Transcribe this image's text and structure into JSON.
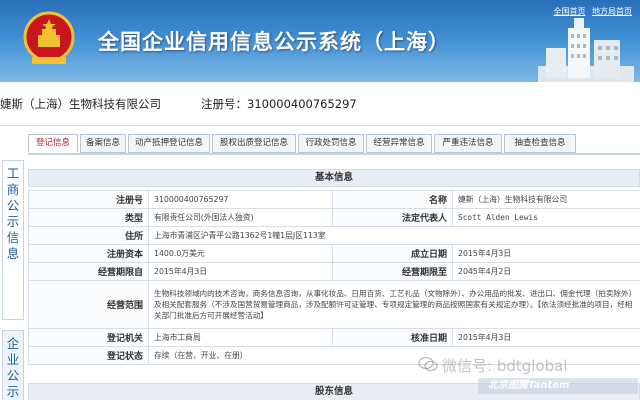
{
  "header": {
    "title": "全国企业信用信息公示系统（上海）",
    "links": [
      "全国首页",
      "地方局首页"
    ]
  },
  "company": {
    "name": "婕斯（上海）生物科技有限公司",
    "reg_label": "注册号：310000400765297"
  },
  "side_tabs": [
    {
      "label": "工商公示信息",
      "chars": [
        "工",
        "商",
        "公",
        "示",
        "信",
        "息"
      ]
    },
    {
      "label": "企业公示",
      "chars": [
        "企",
        "业",
        "公",
        "示"
      ]
    }
  ],
  "tabs": [
    "登记信息",
    "备案信息",
    "动产抵押登记信息",
    "股权出质登记信息",
    "行政处罚信息",
    "经营异常信息",
    "严重违法信息",
    "抽查检查信息"
  ],
  "basic": {
    "title": "基本信息",
    "reg_no_label": "注册号",
    "reg_no": "310000400765297",
    "name_label": "名称",
    "name": "婕斯（上海）生物科技有限公司",
    "type_label": "类型",
    "type": "有限责任公司(外国法人独资)",
    "rep_label": "法定代表人",
    "rep": "Scott Alden Lewis",
    "addr_label": "住所",
    "addr": "上海市青浦区沪青平公路1362号1幢1层J区113室",
    "capital_label": "注册资本",
    "capital": "1400.0万美元",
    "found_label": "成立日期",
    "found": "2015年4月3日",
    "term_from_label": "经营期限自",
    "term_from": "2015年4月3日",
    "term_to_label": "经营期限至",
    "term_to": "2045年4月2日",
    "scope_label": "经营范围",
    "scope": "生物科技领域内的技术咨询，商务信息咨询，从事化妆品、日用百货、工艺礼品（文物除外）、办公用品的批发、进出口、佣金代理（拍卖除外）及相关配套服务（不涉及国营贸易管理商品，涉及配额许可证管理、专项规定管理的商品按照国家有关规定办理）。【依法须经批准的项目，经相关部门批准后方可开展经营活动】",
    "authority_label": "登记机关",
    "authority": "上海市工商局",
    "approval_label": "核准日期",
    "approval": "2015年4月3日",
    "status_label": "登记状态",
    "status": "存续（在营、开业、在册）"
  },
  "shareholders": {
    "title": "股东信息"
  },
  "watermark": {
    "text": "微信号: bdtglobal",
    "strip": "北京图腾Tantem"
  },
  "colors": {
    "banner": "#3f8ed3",
    "active_tab_text": "#c4161c",
    "side_text": "#1f5a9a"
  }
}
